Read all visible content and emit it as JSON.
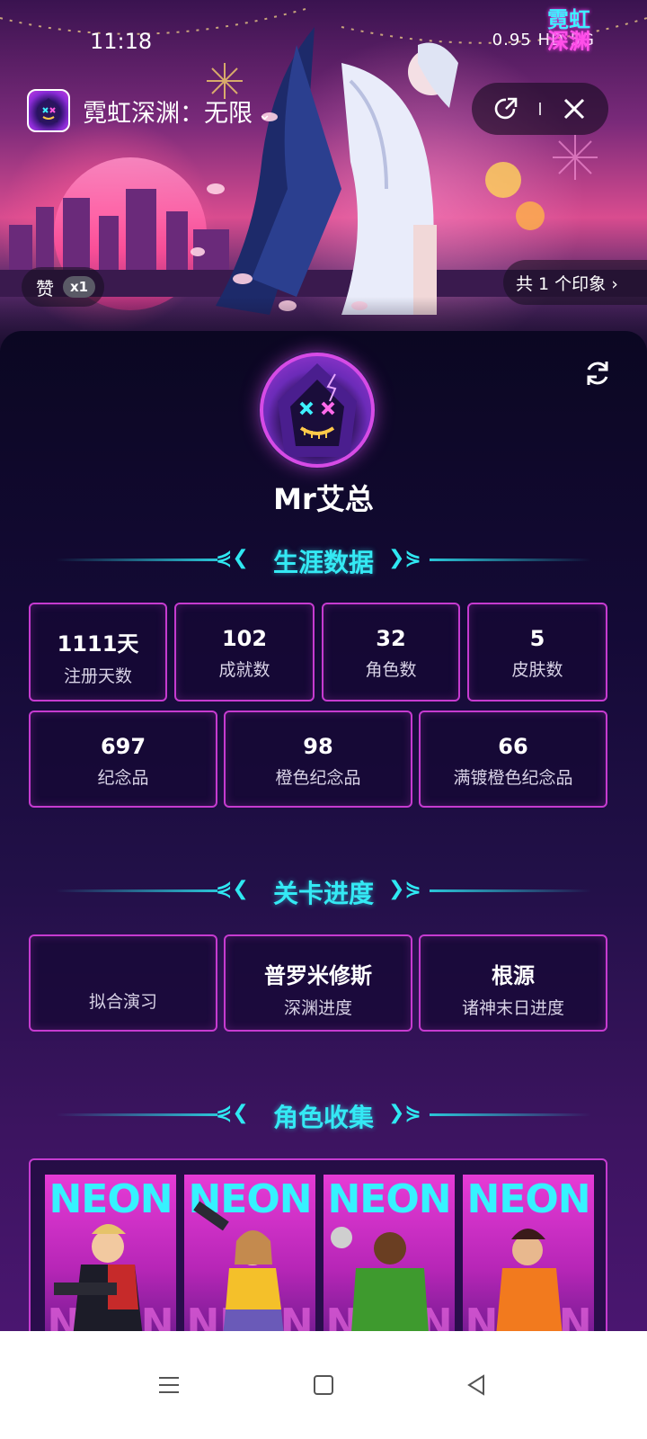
{
  "status_bar": {
    "time": "11:18",
    "indicators": "0.95 HD  5G"
  },
  "corner_logo": {
    "line1": "霓虹",
    "line2": "深渊"
  },
  "header": {
    "app_title": "霓虹深渊：无限",
    "icons": [
      "share-icon",
      "close-icon"
    ]
  },
  "hero": {
    "like_label": "赞",
    "like_count": "x1",
    "impressions": "共 1 个印象 ›"
  },
  "profile": {
    "username": "Mr艾总"
  },
  "career": {
    "title": "生涯数据",
    "row1": [
      {
        "value": "1111天",
        "label": "注册天数"
      },
      {
        "value": "102",
        "label": "成就数"
      },
      {
        "value": "32",
        "label": "角色数"
      },
      {
        "value": "5",
        "label": "皮肤数"
      }
    ],
    "row2": [
      {
        "value": "697",
        "label": "纪念品"
      },
      {
        "value": "98",
        "label": "橙色纪念品"
      },
      {
        "value": "66",
        "label": "满镀橙色纪念品"
      }
    ]
  },
  "progress": {
    "title": "关卡进度",
    "items": [
      {
        "value": "",
        "label": "拟合演习"
      },
      {
        "value": "普罗米修斯",
        "label": "深渊进度"
      },
      {
        "value": "根源",
        "label": "诸神末日进度"
      }
    ]
  },
  "roles": {
    "title": "角色收集",
    "poster_text": "NEON",
    "count": 4
  },
  "colors": {
    "accent_cyan": "#34e9f4",
    "card_border": "#c63bd0",
    "panel_bg": "#140a36"
  }
}
